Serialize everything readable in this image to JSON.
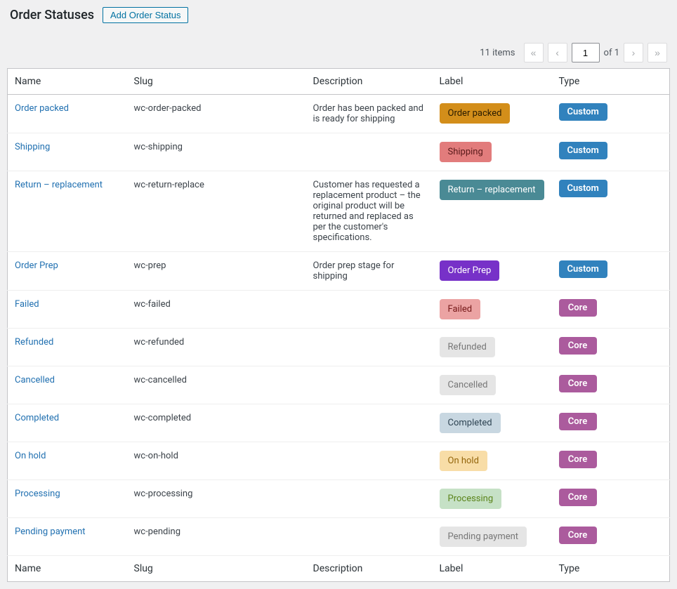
{
  "header": {
    "title": "Order Statuses",
    "add_btn": "Add Order Status"
  },
  "pagination": {
    "items_text": "11 items",
    "first": "«",
    "prev": "‹",
    "page_value": "1",
    "of_text": "of 1",
    "next": "›",
    "last": "»"
  },
  "columns": {
    "name": "Name",
    "slug": "Slug",
    "description": "Description",
    "label": "Label",
    "type": "Type"
  },
  "type_badge": {
    "Custom": {
      "bg": "#3182bd"
    },
    "Core": {
      "bg": "#ab5b9d"
    }
  },
  "rows": [
    {
      "name": "Order packed",
      "slug": "wc-order-packed",
      "description": "Order has been packed and is ready for shipping",
      "label": {
        "text": "Order packed",
        "bg": "#d38e1a",
        "fg": "#2a1c00"
      },
      "type": "Custom"
    },
    {
      "name": "Shipping",
      "slug": "wc-shipping",
      "description": "",
      "label": {
        "text": "Shipping",
        "bg": "#e27c7c",
        "fg": "#5a1a1a"
      },
      "type": "Custom"
    },
    {
      "name": "Return – replacement",
      "slug": "wc-return-replace",
      "description": "Customer has requested a replacement product – the original product will be returned and replaced as per the customer's specifications.",
      "label": {
        "text": "Return – replacement",
        "bg": "#4a8a95",
        "fg": "#ffffff"
      },
      "type": "Custom"
    },
    {
      "name": "Order Prep",
      "slug": "wc-prep",
      "description": "Order prep stage for shipping",
      "label": {
        "text": "Order Prep",
        "bg": "#7731c8",
        "fg": "#ffffff"
      },
      "type": "Custom"
    },
    {
      "name": "Failed",
      "slug": "wc-failed",
      "description": "",
      "label": {
        "text": "Failed",
        "bg": "#eba3a3",
        "fg": "#761919"
      },
      "type": "Core"
    },
    {
      "name": "Refunded",
      "slug": "wc-refunded",
      "description": "",
      "label": {
        "text": "Refunded",
        "bg": "#e5e5e5",
        "fg": "#777777"
      },
      "type": "Core"
    },
    {
      "name": "Cancelled",
      "slug": "wc-cancelled",
      "description": "",
      "label": {
        "text": "Cancelled",
        "bg": "#e5e5e5",
        "fg": "#777777"
      },
      "type": "Core"
    },
    {
      "name": "Completed",
      "slug": "wc-completed",
      "description": "",
      "label": {
        "text": "Completed",
        "bg": "#c8d7e1",
        "fg": "#2e4453"
      },
      "type": "Core"
    },
    {
      "name": "On hold",
      "slug": "wc-on-hold",
      "description": "",
      "label": {
        "text": "On hold",
        "bg": "#f8dda7",
        "fg": "#94660c"
      },
      "type": "Core"
    },
    {
      "name": "Processing",
      "slug": "wc-processing",
      "description": "",
      "label": {
        "text": "Processing",
        "bg": "#c6e1c6",
        "fg": "#5b841b"
      },
      "type": "Core"
    },
    {
      "name": "Pending payment",
      "slug": "wc-pending",
      "description": "",
      "label": {
        "text": "Pending payment",
        "bg": "#e5e5e5",
        "fg": "#777777"
      },
      "type": "Core"
    }
  ]
}
